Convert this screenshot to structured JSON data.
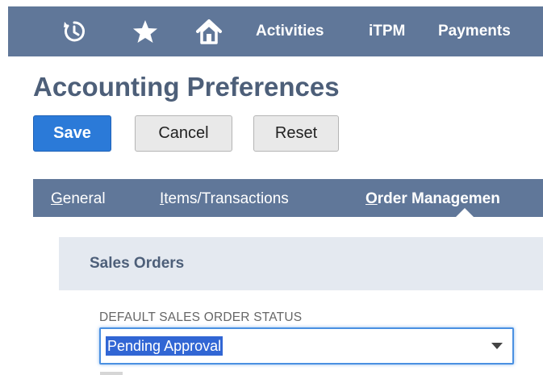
{
  "topnav": {
    "icons": [
      {
        "name": "recent-icon"
      },
      {
        "name": "star-icon"
      },
      {
        "name": "home-icon"
      }
    ],
    "links": [
      "Activities",
      "iTPM",
      "Payments"
    ],
    "bar_color": "#607799"
  },
  "page": {
    "title": "Accounting Preferences"
  },
  "actions": {
    "save": "Save",
    "cancel": "Cancel",
    "reset": "Reset",
    "primary_color": "#2b7ad8"
  },
  "tabs": [
    {
      "accel": "G",
      "rest": "eneral",
      "active": false
    },
    {
      "accel": "I",
      "rest": "tems/Transactions",
      "active": false
    },
    {
      "accel": "O",
      "rest": "rder Managemen",
      "active": true
    }
  ],
  "section": {
    "title": "Sales Orders"
  },
  "fields": {
    "default_sales_order_status": {
      "label": "DEFAULT SALES ORDER STATUS",
      "value": "Pending Approval"
    }
  }
}
